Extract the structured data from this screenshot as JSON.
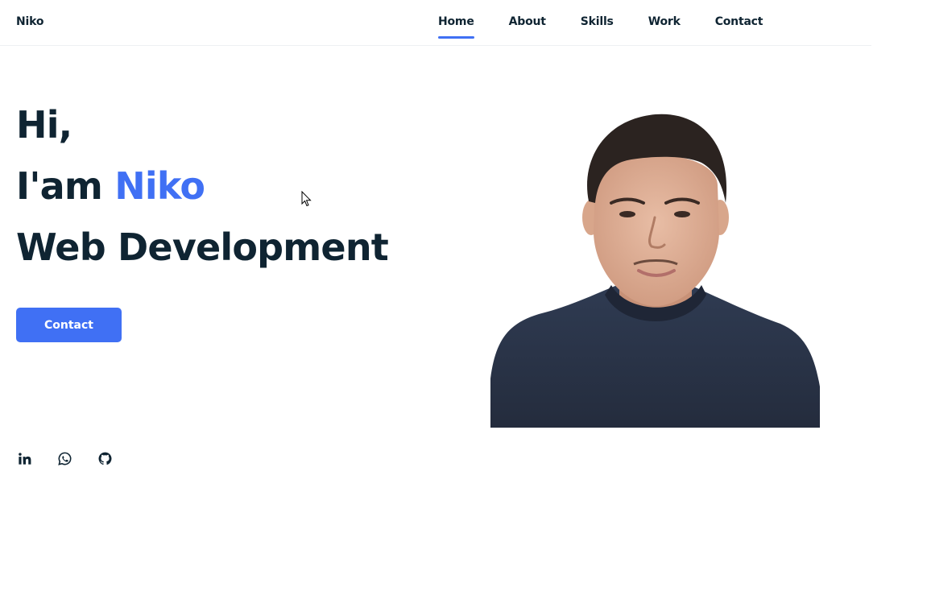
{
  "header": {
    "logo": "Niko",
    "nav": [
      {
        "label": "Home",
        "active": true
      },
      {
        "label": "About",
        "active": false
      },
      {
        "label": "Skills",
        "active": false
      },
      {
        "label": "Work",
        "active": false
      },
      {
        "label": "Contact",
        "active": false
      }
    ]
  },
  "hero": {
    "line1": "Hi,",
    "line2_prefix": "I'am ",
    "line2_name": "Niko",
    "line3": "Web Development",
    "button_label": "Contact"
  },
  "socials": [
    {
      "icon": "linkedin-icon"
    },
    {
      "icon": "whatsapp-icon"
    },
    {
      "icon": "github-icon"
    }
  ],
  "photo": {
    "subject": "portrait-photo"
  },
  "colors": {
    "accent": "#4070f4",
    "text": "#0f2432",
    "background": "#ffffff"
  }
}
